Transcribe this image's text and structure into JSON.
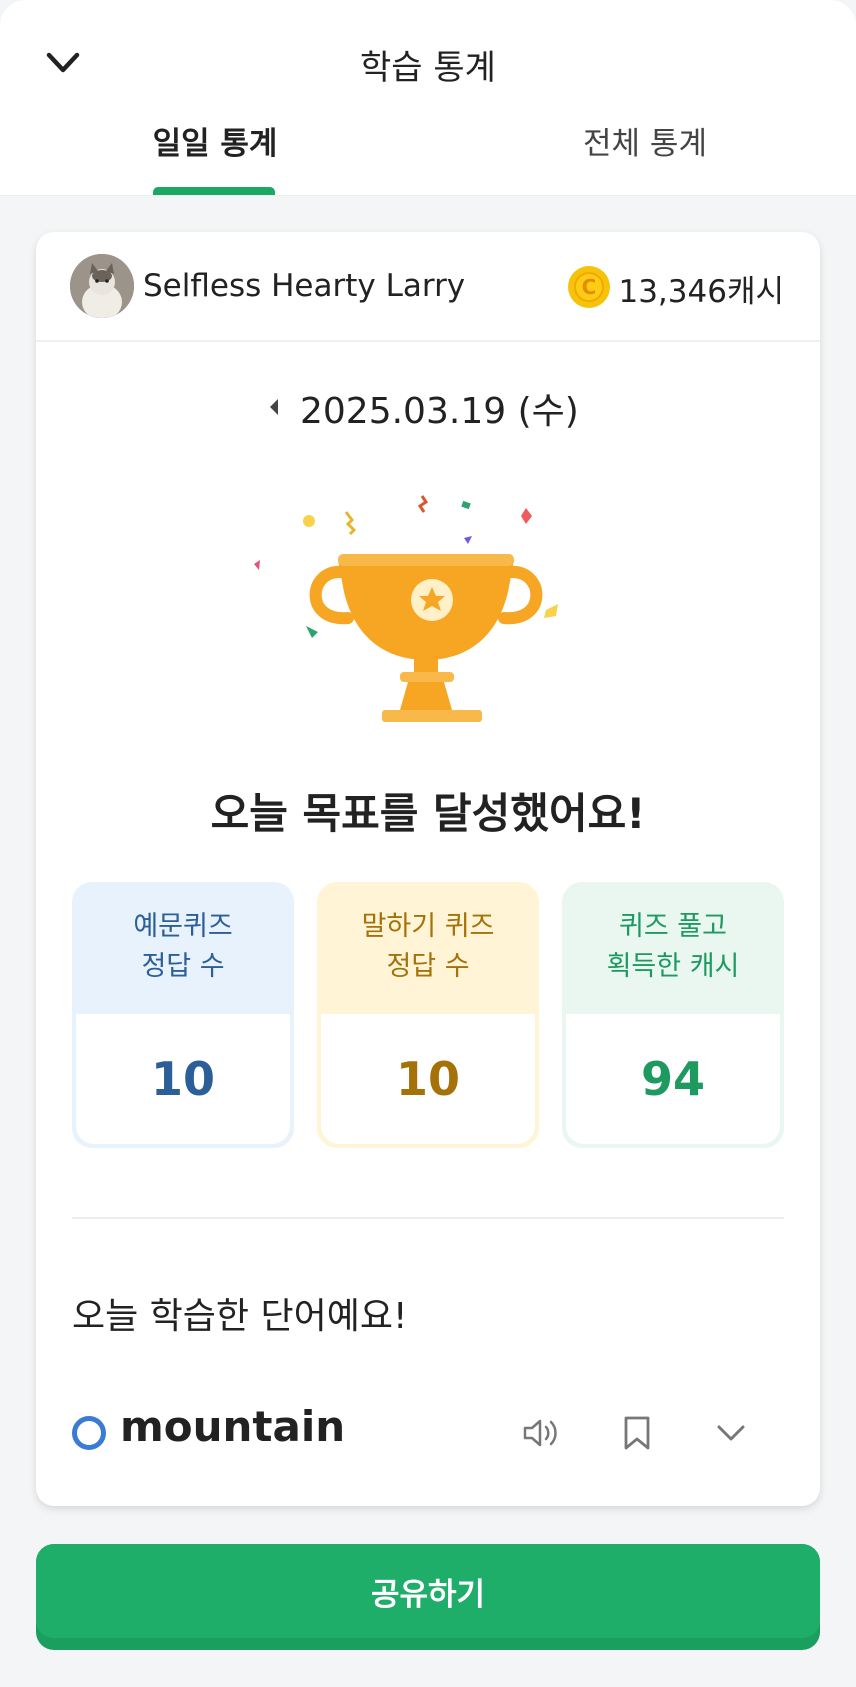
{
  "header": {
    "title": "학습 통계",
    "tabs": [
      {
        "label": "일일 통계",
        "active": true
      },
      {
        "label": "전체 통계",
        "active": false
      }
    ]
  },
  "profile": {
    "name": "Selfless Hearty Larry",
    "cash": "13,346캐시",
    "coin_symbol": "C"
  },
  "date": {
    "label": "2025.03.19 (수)"
  },
  "goal_message": "오늘 목표를 달성했어요!",
  "stats": [
    {
      "label_line1": "예문퀴즈",
      "label_line2": "정답 수",
      "value": "10",
      "color": "#2c5f97"
    },
    {
      "label_line1": "말하기 퀴즈",
      "label_line2": "정답 수",
      "value": "10",
      "color": "#a5720a"
    },
    {
      "label_line1": "퀴즈 풀고",
      "label_line2": "획득한 캐시",
      "value": "94",
      "color": "#1e9a60"
    }
  ],
  "words_section": {
    "title": "오늘 학습한 단어예요!",
    "items": [
      {
        "word": "mountain",
        "mark": "circle-correct"
      }
    ]
  },
  "share_button": "공유하기",
  "colors": {
    "accent_green": "#1fae6a",
    "coin_yellow": "#f7c20a",
    "trophy_orange": "#f6a623"
  }
}
